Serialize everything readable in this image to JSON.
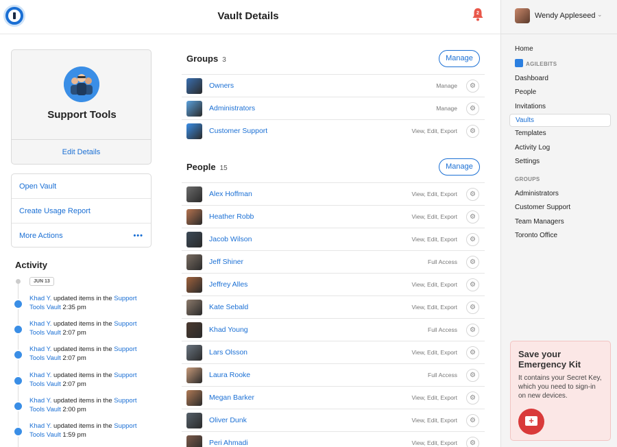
{
  "header": {
    "title": "Vault Details",
    "notifications": "2"
  },
  "user": {
    "name": "Wendy Appleseed"
  },
  "sidebar": {
    "top_items": [
      {
        "label": "Home"
      }
    ],
    "team_label": "AGILEBITS",
    "team_items": [
      {
        "label": "Dashboard"
      },
      {
        "label": "People"
      },
      {
        "label": "Invitations"
      },
      {
        "label": "Vaults",
        "active": true
      },
      {
        "label": "Templates"
      },
      {
        "label": "Activity Log"
      },
      {
        "label": "Settings"
      }
    ],
    "groups_label": "GROUPS",
    "group_items": [
      {
        "label": "Administrators"
      },
      {
        "label": "Customer Support"
      },
      {
        "label": "Team Managers"
      },
      {
        "label": "Toronto Office"
      }
    ]
  },
  "emergency_kit": {
    "title": "Save your Emergency Kit",
    "text": "It contains your Secret Key, which you need to sign-in on new devices."
  },
  "vault": {
    "name": "Support Tools",
    "edit_label": "Edit Details"
  },
  "actions": [
    {
      "label": "Open Vault"
    },
    {
      "label": "Create Usage Report"
    },
    {
      "label": "More Actions",
      "more": "•••"
    }
  ],
  "activity": {
    "title": "Activity",
    "date": "JUN 13",
    "items": [
      {
        "user": "Khad Y.",
        "action": " updated items in the ",
        "vault_a": "Support",
        "vault_b": "Tools Vault",
        "time": "2:35 pm"
      },
      {
        "user": "Khad Y.",
        "action": " updated items in the ",
        "vault_a": "Support",
        "vault_b": "Tools Vault",
        "time": "2:07 pm"
      },
      {
        "user": "Khad Y.",
        "action": " updated items in the ",
        "vault_a": "Support",
        "vault_b": "Tools Vault",
        "time": "2:07 pm"
      },
      {
        "user": "Khad Y.",
        "action": " updated items in the ",
        "vault_a": "Support",
        "vault_b": "Tools Vault",
        "time": "2:07 pm"
      },
      {
        "user": "Khad Y.",
        "action": " updated items in the ",
        "vault_a": "Support",
        "vault_b": "Tools Vault",
        "time": "2:00 pm"
      },
      {
        "user": "Khad Y.",
        "action": " updated items in the ",
        "vault_a": "Support",
        "vault_b": "Tools Vault",
        "time": "1:59 pm"
      }
    ]
  },
  "groups": {
    "title": "Groups",
    "count": "3",
    "manage_label": "Manage",
    "rows": [
      {
        "name": "Owners",
        "perm": "Manage",
        "color": "#3a6fb0"
      },
      {
        "name": "Administrators",
        "perm": "Manage",
        "color": "#5aa0dc"
      },
      {
        "name": "Customer Support",
        "perm": "View, Edit, Export",
        "color": "#3a8ee6"
      }
    ]
  },
  "people": {
    "title": "People",
    "count": "15",
    "manage_label": "Manage",
    "rows": [
      {
        "name": "Alex Hoffman",
        "perm": "View, Edit, Export",
        "color": "#6b6b6b"
      },
      {
        "name": "Heather Robb",
        "perm": "View, Edit, Export",
        "color": "#b5734f"
      },
      {
        "name": "Jacob Wilson",
        "perm": "View, Edit, Export",
        "color": "#3c4a57"
      },
      {
        "name": "Jeff Shiner",
        "perm": "Full Access",
        "color": "#7a6d62"
      },
      {
        "name": "Jeffrey Alles",
        "perm": "View, Edit, Export",
        "color": "#a0623d"
      },
      {
        "name": "Kate Sebald",
        "perm": "View, Edit, Export",
        "color": "#8c7a6b"
      },
      {
        "name": "Khad Young",
        "perm": "Full Access",
        "color": "#4b3a30"
      },
      {
        "name": "Lars Olsson",
        "perm": "View, Edit, Export",
        "color": "#6a7580"
      },
      {
        "name": "Laura Rooke",
        "perm": "Full Access",
        "color": "#c79a7a"
      },
      {
        "name": "Megan Barker",
        "perm": "View, Edit, Export",
        "color": "#b07a55"
      },
      {
        "name": "Oliver Dunk",
        "perm": "View, Edit, Export",
        "color": "#55606a"
      },
      {
        "name": "Peri Ahmadi",
        "perm": "View, Edit, Export",
        "color": "#7b5a4a"
      }
    ]
  }
}
